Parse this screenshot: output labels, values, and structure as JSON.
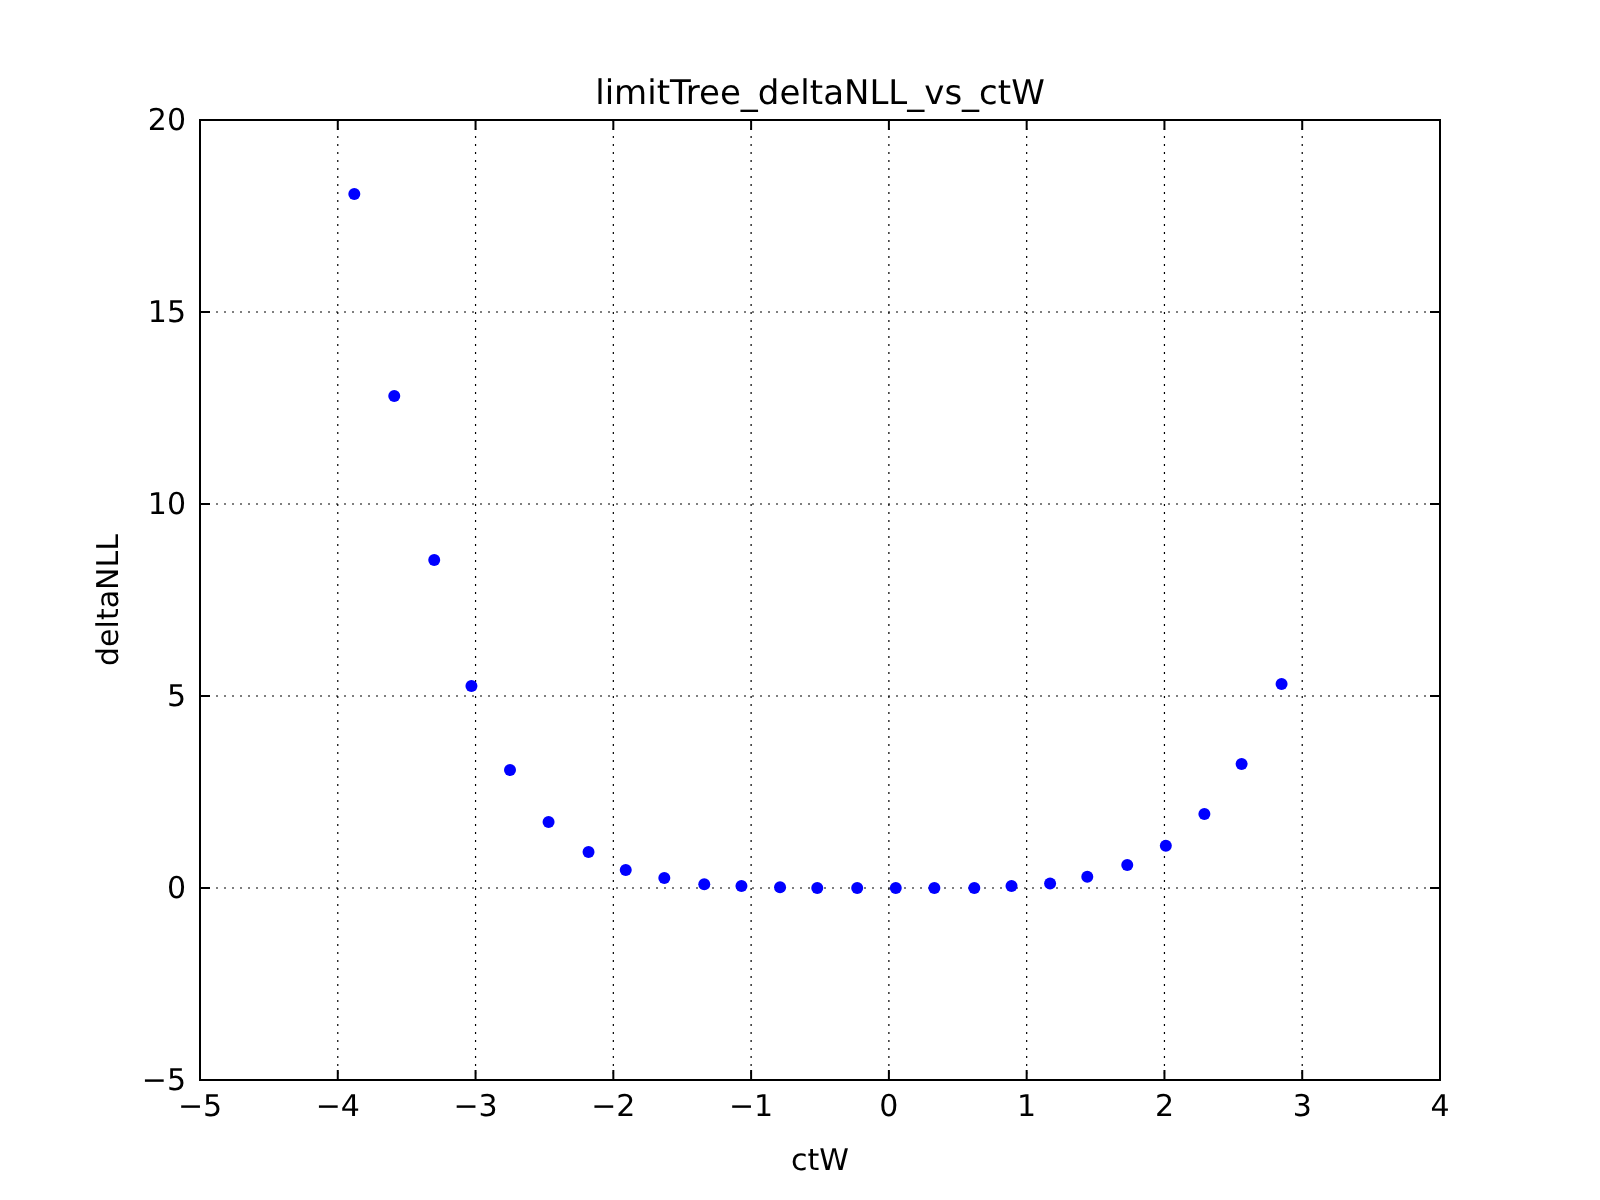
{
  "chart_data": {
    "type": "scatter",
    "title": "limitTree_deltaNLL_vs_ctW",
    "xlabel": "ctW",
    "ylabel": "deltaNLL",
    "grid": true,
    "series": [
      {
        "color": "#0000ff",
        "x": [
          -3.88,
          -3.59,
          -3.3,
          -3.03,
          -2.75,
          -2.47,
          -2.18,
          -1.91,
          -1.63,
          -1.34,
          -1.07,
          -0.79,
          -0.52,
          -0.23,
          0.05,
          0.33,
          0.62,
          0.89,
          1.17,
          1.44,
          1.73,
          2.01,
          2.29,
          2.56,
          2.85
        ],
        "values": [
          18.07,
          12.81,
          8.54,
          5.26,
          3.07,
          1.72,
          0.94,
          0.47,
          0.26,
          0.1,
          0.05,
          0.02,
          0.0,
          0.0,
          0.0,
          0.0,
          0.0,
          0.05,
          0.12,
          0.29,
          0.6,
          1.1,
          1.93,
          3.23,
          5.31
        ]
      }
    ],
    "xlim": [
      -5,
      4
    ],
    "ylim": [
      -5,
      20
    ],
    "xticks": [
      -5,
      -4,
      -3,
      -2,
      -1,
      0,
      1,
      2,
      3,
      4
    ],
    "yticks": [
      -5,
      0,
      5,
      10,
      15,
      20
    ]
  }
}
